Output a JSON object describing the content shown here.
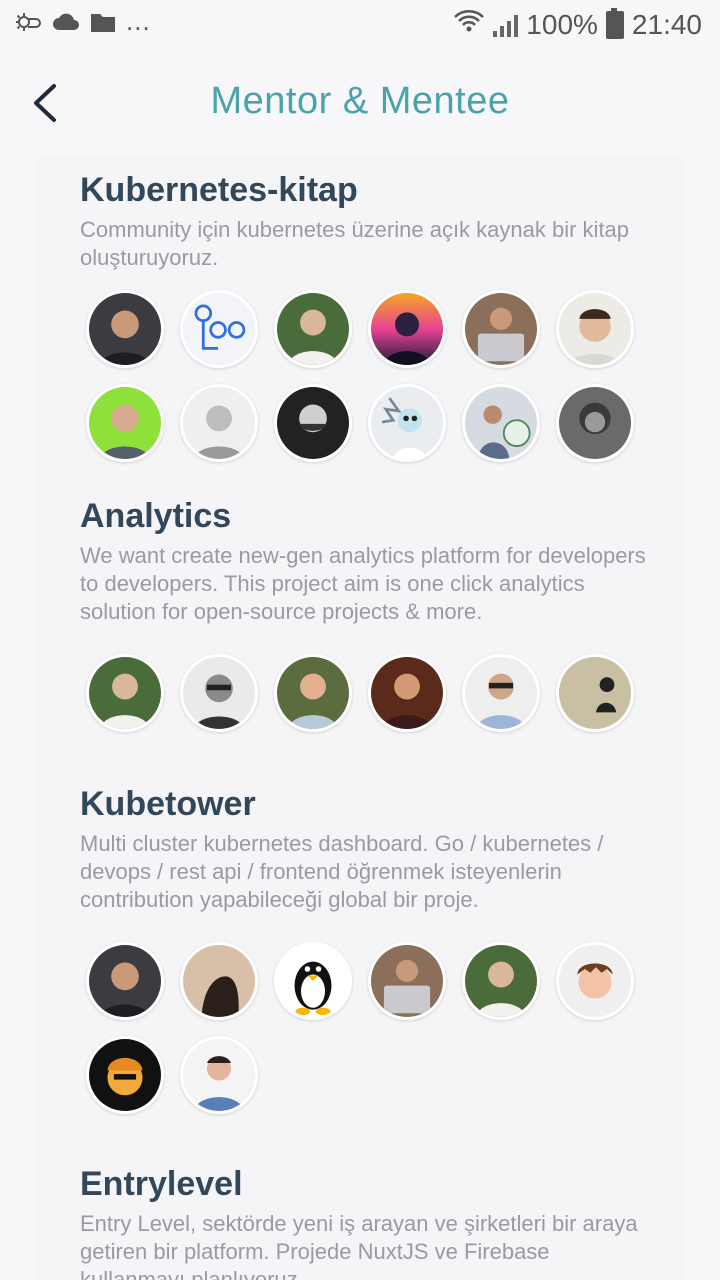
{
  "status_bar": {
    "overflow": "...",
    "battery": "100%",
    "time": "21:40"
  },
  "header": {
    "title": "Mentor & Mentee"
  },
  "projects": [
    {
      "title": "Kubernetes-kitap",
      "description": "Community için kubernetes üzerine açık kaynak bir kitap oluşturuyoruz.",
      "members": 12
    },
    {
      "title": "Analytics",
      "description": "We want create new-gen analytics platform for developers to developers. This project aim is one click analytics solution for open-source projects & more.",
      "members": 6
    },
    {
      "title": "Kubetower",
      "description": "Multi cluster kubernetes dashboard. Go / kubernetes / devops / rest api / frontend öğrenmek isteyenlerin contribution yapabileceği global bir proje.",
      "members": 8
    },
    {
      "title": "Entrylevel",
      "description": "Entry Level, sektörde yeni iş arayan ve şirketleri bir araya getiren bir platform. Projede NuxtJS ve Firebase kullanmayı planlıyoruz."
    }
  ],
  "colors": {
    "title": "#4aa3aa",
    "project_title": "#33475b",
    "description": "#9a9aa2",
    "background": "#f7f7f9"
  }
}
